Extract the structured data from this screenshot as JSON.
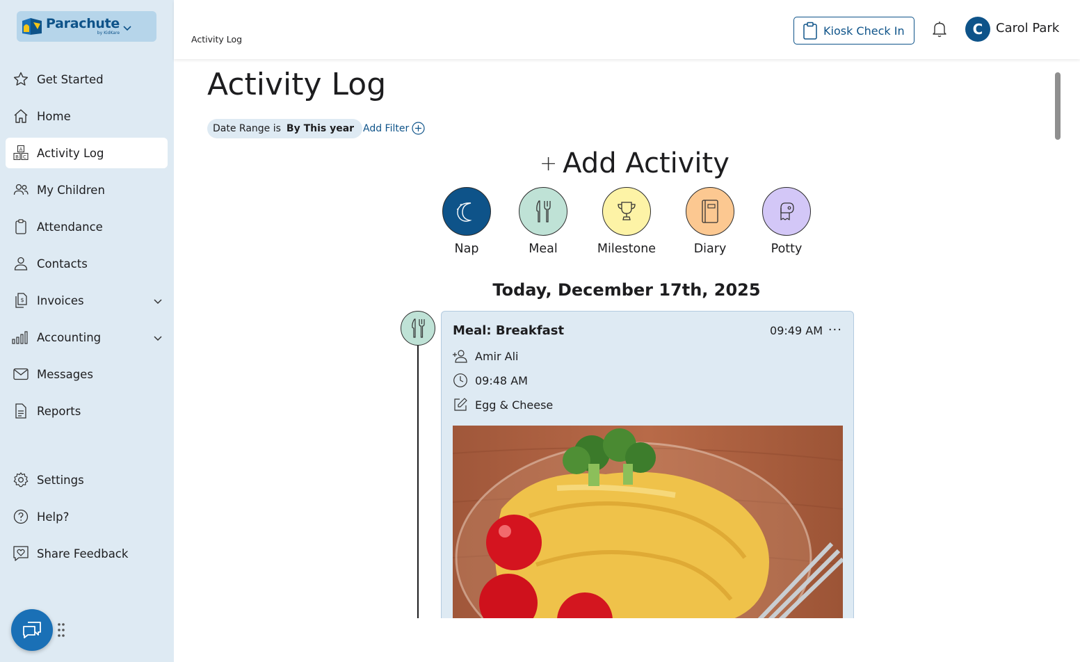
{
  "brand": {
    "name": "Parachute",
    "sub": "by KidKare"
  },
  "sidebar": {
    "items": [
      {
        "label": "Get Started",
        "icon": "star-icon"
      },
      {
        "label": "Home",
        "icon": "home-icon"
      },
      {
        "label": "Activity Log",
        "icon": "abc-blocks-icon",
        "active": true
      },
      {
        "label": "My Children",
        "icon": "children-icon"
      },
      {
        "label": "Attendance",
        "icon": "clipboard-icon"
      },
      {
        "label": "Contacts",
        "icon": "person-icon"
      },
      {
        "label": "Invoices",
        "icon": "invoice-icon",
        "expandable": true
      },
      {
        "label": "Accounting",
        "icon": "bar-chart-icon",
        "expandable": true
      },
      {
        "label": "Messages",
        "icon": "envelope-icon"
      },
      {
        "label": "Reports",
        "icon": "document-icon"
      },
      {
        "label": "Settings",
        "icon": "gear-icon"
      },
      {
        "label": "Help?",
        "icon": "question-icon"
      },
      {
        "label": "Share Feedback",
        "icon": "heart-chat-icon"
      }
    ]
  },
  "header": {
    "breadcrumb": "Activity Log",
    "kiosk_label": "Kiosk Check In",
    "user_initial": "C",
    "user_name": "Carol Park"
  },
  "main": {
    "title": "Activity Log",
    "filter": {
      "prefix": "Date Range is",
      "value": "By This year"
    },
    "add_filter": "Add Filter",
    "add_activity": "Add Activity",
    "activities": [
      {
        "label": "Nap",
        "color": "#0e5389"
      },
      {
        "label": "Meal",
        "color": "#bfe2d6"
      },
      {
        "label": "Milestone",
        "color": "#fdf3a6"
      },
      {
        "label": "Diary",
        "color": "#fcc891"
      },
      {
        "label": "Potty",
        "color": "#d3c7f7"
      }
    ],
    "date_heading": "Today, December 17th, 2025",
    "entry": {
      "title": "Meal: Breakfast",
      "time": "09:49 AM",
      "more": "···",
      "child": "Amir Ali",
      "recorded_time": "09:48 AM",
      "note": "Egg & Cheese"
    }
  },
  "colors": {
    "primary": "#0e5389",
    "sidebar_bg": "#deeaf3",
    "card_bg": "#deeaf3"
  }
}
